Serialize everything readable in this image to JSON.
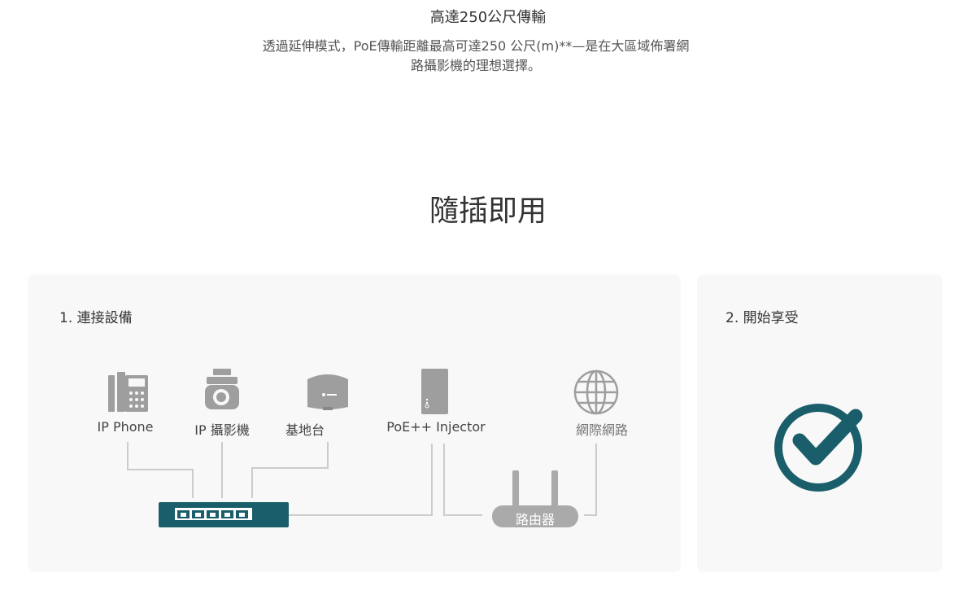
{
  "intro": {
    "title": "高達250公尺傳輸",
    "description_line1": "透過延伸模式，PoE傳輸距離最高可達250 公尺(m)**—是在大區域佈署網",
    "description_line2": "路攝影機的理想選擇。"
  },
  "section_title": "隨插即用",
  "step1": {
    "label": "1. 連接設備",
    "devices": {
      "ip_phone": "IP Phone",
      "ip_camera": "IP 攝影機",
      "base_station": "基地台",
      "injector": "PoE++ Injector",
      "internet": "網際網路"
    },
    "router_label": "路由器"
  },
  "step2": {
    "label": "2. 開始享受"
  },
  "colors": {
    "accent": "#1b5e6b",
    "icon_gray": "#9e9e9e",
    "line_gray": "#c8c8c8",
    "card_bg": "#f8f8f8"
  }
}
